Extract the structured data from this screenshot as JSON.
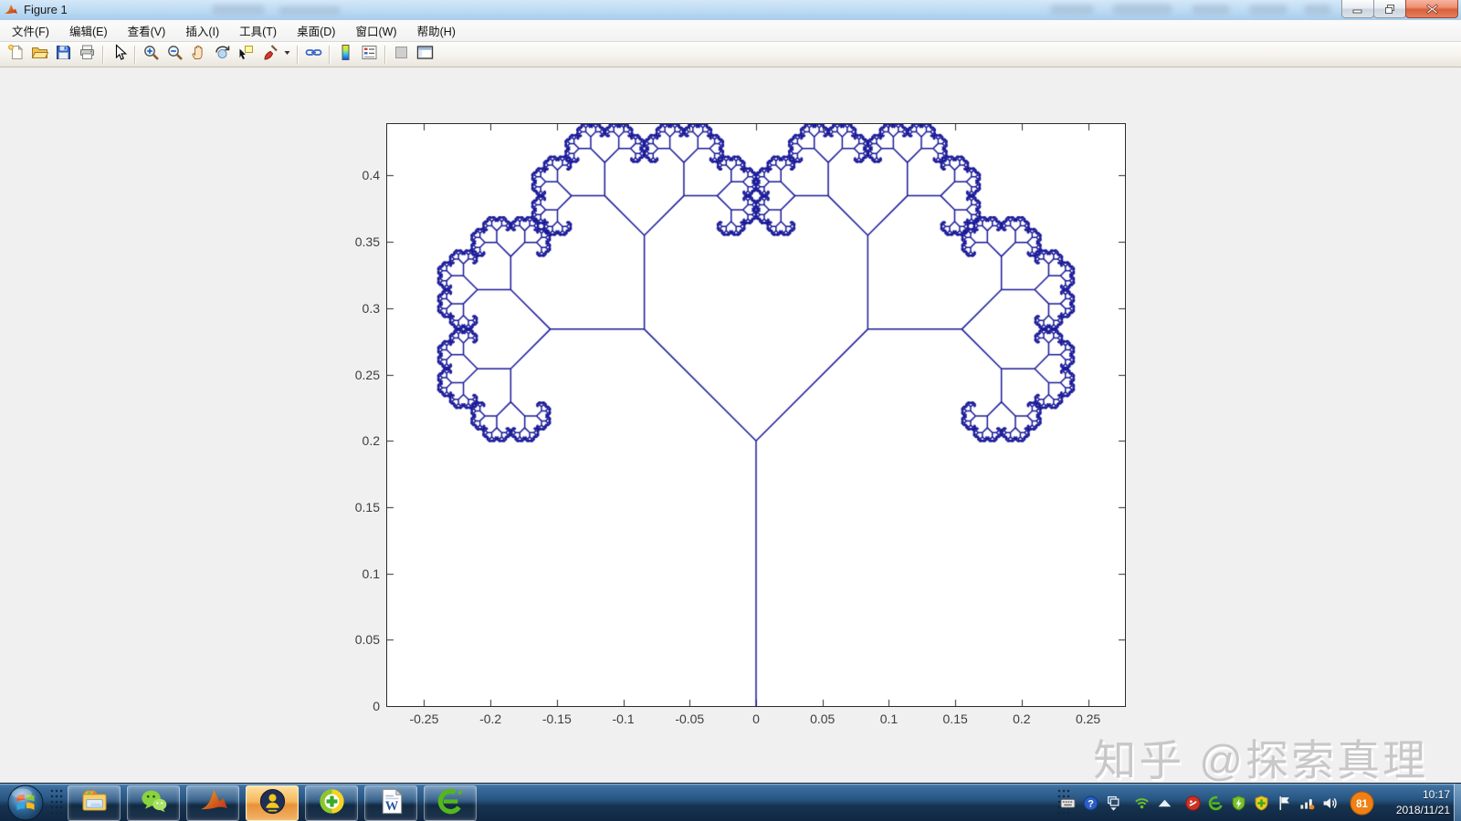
{
  "window": {
    "title": "Figure 1",
    "app_icon": "matlab-logo-icon",
    "controls": [
      "minimize",
      "restore",
      "close"
    ]
  },
  "menu_bar": {
    "items": [
      {
        "label": "文件(F)"
      },
      {
        "label": "编辑(E)"
      },
      {
        "label": "查看(V)"
      },
      {
        "label": "插入(I)"
      },
      {
        "label": "工具(T)"
      },
      {
        "label": "桌面(D)"
      },
      {
        "label": "窗口(W)"
      },
      {
        "label": "帮助(H)"
      }
    ]
  },
  "toolbar": {
    "items": [
      {
        "icon": "new-document-icon"
      },
      {
        "icon": "open-folder-icon"
      },
      {
        "icon": "save-icon"
      },
      {
        "icon": "print-icon"
      },
      {
        "type": "separator"
      },
      {
        "icon": "pointer-icon"
      },
      {
        "type": "separator"
      },
      {
        "icon": "zoom-in-icon"
      },
      {
        "icon": "zoom-out-icon"
      },
      {
        "icon": "pan-hand-icon"
      },
      {
        "icon": "rotate-3d-icon"
      },
      {
        "icon": "data-cursor-icon"
      },
      {
        "icon": "brush-icon"
      },
      {
        "icon": "dropdown-arrow-icon",
        "narrow": true
      },
      {
        "type": "separator"
      },
      {
        "icon": "link-plots-icon"
      },
      {
        "type": "separator"
      },
      {
        "icon": "colorbar-icon"
      },
      {
        "icon": "legend-icon"
      },
      {
        "type": "separator"
      },
      {
        "icon": "hide-plot-tools-icon"
      },
      {
        "icon": "show-plot-tools-icon"
      }
    ]
  },
  "chart_data": {
    "type": "line",
    "description": "Symmetric binary fractal tree (分形树) plotted in MATLAB; trunk at x=0 splits repeatedly into two branches rotated ±45° with length ratio ≈0.595",
    "title": "",
    "xlabel": "",
    "ylabel": "",
    "grid": false,
    "box": true,
    "line_color": "#1A1A99",
    "background": "#ffffff",
    "figure_background": "#f0f0f0",
    "fractal_params": {
      "origin": [
        0,
        0
      ],
      "trunk_length": 0.2,
      "branch_angle_deg": 45,
      "length_ratio": 0.595,
      "recursion_depth": 14
    },
    "xlim": [
      -0.2778,
      0.2778
    ],
    "ylim": [
      0,
      0.4388
    ],
    "x_ticks": {
      "values": [
        -0.25,
        -0.2,
        -0.15,
        -0.1,
        -0.05,
        0,
        0.05,
        0.1,
        0.15,
        0.2,
        0.25
      ],
      "labels": [
        "-0.25",
        "-0.2",
        "-0.15",
        "-0.1",
        "-0.05",
        "0",
        "0.05",
        "0.1",
        "0.15",
        "0.2",
        "0.25"
      ]
    },
    "y_ticks": {
      "values": [
        0,
        0.05,
        0.1,
        0.15,
        0.2,
        0.25,
        0.3,
        0.35,
        0.4
      ],
      "labels": [
        "0",
        "0.05",
        "0.1",
        "0.15",
        "0.2",
        "0.25",
        "0.3",
        "0.35",
        "0.4"
      ]
    }
  },
  "watermark": {
    "text": "知乎 @探索真理",
    "color": "#c8c8c8"
  },
  "taskbar": {
    "start": {
      "icon": "windows-start-icon"
    },
    "apps": [
      {
        "name": "windows-explorer",
        "icon": "explorer-icon",
        "active": false
      },
      {
        "name": "wechat",
        "icon": "wechat-icon",
        "active": false
      },
      {
        "name": "matlab",
        "icon": "matlab-app-icon",
        "active": false
      },
      {
        "name": "avatar-app",
        "icon": "avatar-app-icon",
        "active": true
      },
      {
        "name": "360-safety",
        "icon": "safety-360-icon",
        "active": false
      },
      {
        "name": "word",
        "icon": "word-icon",
        "active": false
      },
      {
        "name": "360-browser",
        "icon": "browser-360-icon",
        "active": false
      }
    ],
    "tray": {
      "icons": [
        {
          "name": "keyboard-icon"
        },
        {
          "name": "help-icon"
        },
        {
          "name": "window-popup-icon"
        },
        {
          "name": "wifi-icon",
          "gap": true
        },
        {
          "name": "up-arrow-icon"
        },
        {
          "name": "red-app-icon",
          "gap": true
        },
        {
          "name": "browser-e-icon"
        },
        {
          "name": "shield-bolt-icon"
        },
        {
          "name": "shield-plus-icon"
        },
        {
          "name": "flag-icon"
        },
        {
          "name": "network-signal-icon"
        },
        {
          "name": "volume-icon"
        },
        {
          "name": "speed-ball-icon",
          "label": "81",
          "big": true,
          "gap": true
        }
      ],
      "clock": {
        "time": "10:17",
        "date": "2018/11/21"
      }
    }
  }
}
